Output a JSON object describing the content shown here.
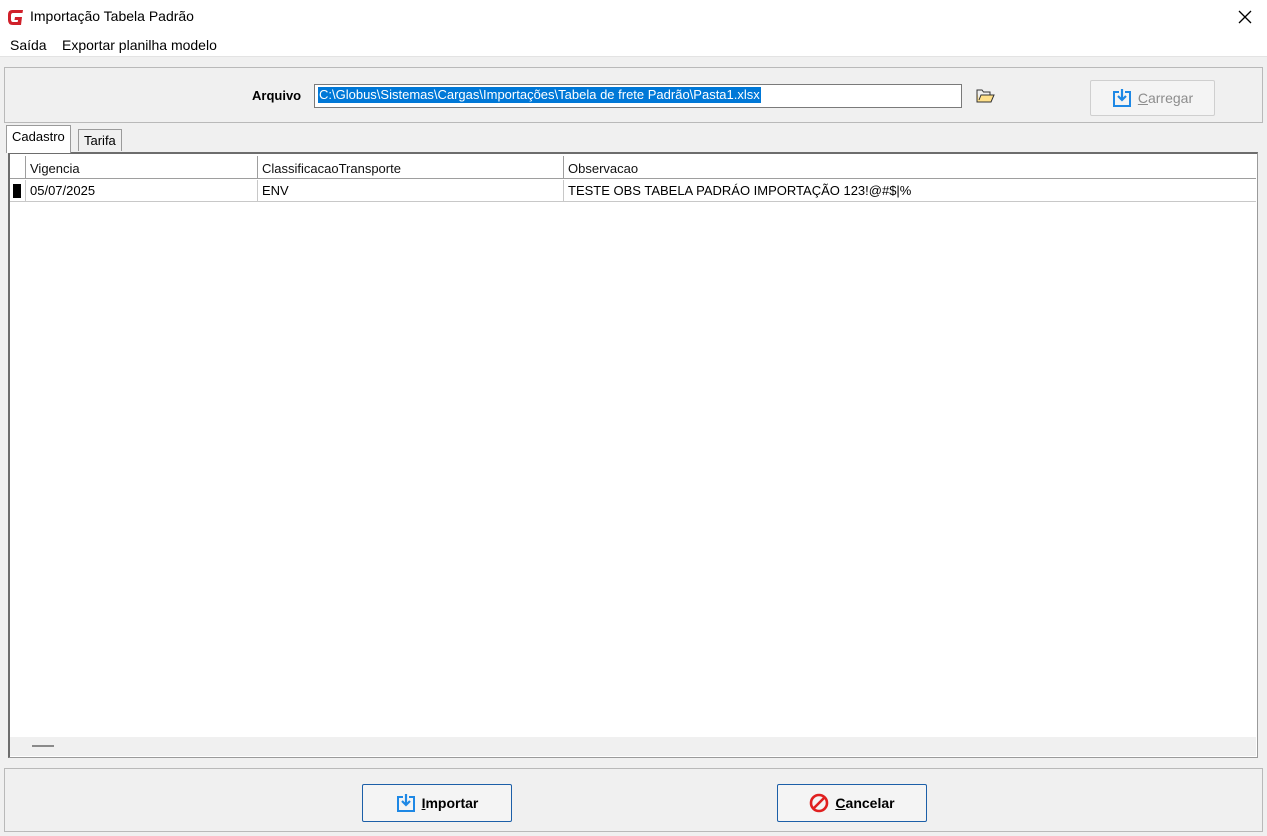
{
  "window": {
    "title": "Importação Tabela Padrão"
  },
  "menu": {
    "items": [
      "Saída",
      "Exportar planilha modelo"
    ]
  },
  "file": {
    "label": "Arquivo",
    "path": "C:\\Globus\\Sistemas\\Cargas\\Importações\\Tabela de frete Padrão\\Pasta1.xlsx",
    "load_button": {
      "underline": "C",
      "rest": "arregar"
    }
  },
  "tabs": [
    {
      "label": "Cadastro"
    },
    {
      "label": "Tarifa"
    }
  ],
  "grid": {
    "columns": [
      "Vigencia",
      "ClassificacaoTransporte",
      "Observacao"
    ],
    "rows": [
      [
        "05/07/2025",
        "ENV",
        "TESTE OBS TABELA PADRÁO IMPORTAÇÃO 123!@#$|%"
      ]
    ]
  },
  "actions": {
    "import": {
      "underline": "I",
      "rest": "mportar"
    },
    "cancel": {
      "underline": "C",
      "rest": "ancelar"
    }
  },
  "colors": {
    "accent": "#0078d7",
    "icon_blue": "#1e88e5",
    "cancel_red": "#e02020",
    "brand_red": "#d0202a"
  }
}
